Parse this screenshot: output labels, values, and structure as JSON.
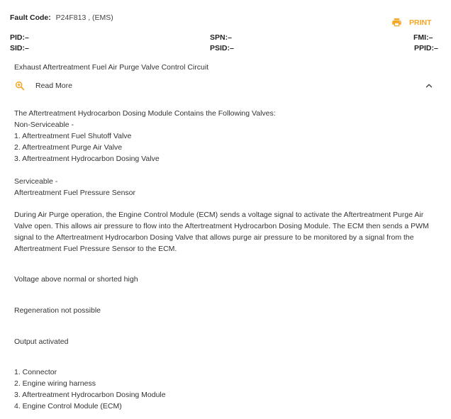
{
  "header": {
    "fault_code_label": "Fault Code:",
    "fault_code_value": "P24F813 , (EMS)",
    "print_label": "PRINT"
  },
  "codes": {
    "pid": "PID:–",
    "spn": "SPN:–",
    "fmi": "FMI:–",
    "sid": "SID:–",
    "psid": "PSID:–",
    "ppid": "PPID:–"
  },
  "description": {
    "title": "Exhaust Aftertreatment Fuel Air Purge Valve Control Circuit",
    "read_more": "Read More",
    "valves_intro": "The Aftertreatment Hydrocarbon Dosing Module Contains the Following Valves:",
    "non_serviceable_heading": "Non-Serviceable -",
    "non_serviceable_items": [
      "1. Aftertreatment Fuel Shutoff Valve",
      "2. Aftertreatment Purge Air Valve",
      "3. Aftertreatment Hydrocarbon Dosing Valve"
    ],
    "serviceable_heading": "Serviceable -",
    "serviceable_item": "Aftertreatment Fuel Pressure Sensor",
    "operation_lines": [
      "During Air Purge operation, the Engine Control Module (ECM) sends a voltage signal to activate the Aftertreatment Purge Air",
      "Valve open. This allows air pressure to flow into the Aftertreatment Hydrocarbon Dosing Module. The ECM then sends a PWM",
      "signal to the Aftertreatment Hydrocarbon Dosing Valve that allows purge air pressure to be monitored by a signal from the",
      "Aftertreatment Fuel Pressure Sensor to the ECM."
    ],
    "condition": "Voltage above normal or shorted high",
    "effect": "Regeneration not possible",
    "output": "Output activated",
    "components": [
      "1. Connector",
      "2. Engine wiring harness",
      "3. Aftertreatment Hydrocarbon Dosing Module",
      "4. Engine Control Module (ECM)"
    ]
  },
  "colors": {
    "accent": "#f5a623",
    "text": "#333333"
  },
  "icons": {
    "print": "printer-icon",
    "read_more": "zoom-in-icon",
    "collapse": "chevron-up-icon"
  }
}
